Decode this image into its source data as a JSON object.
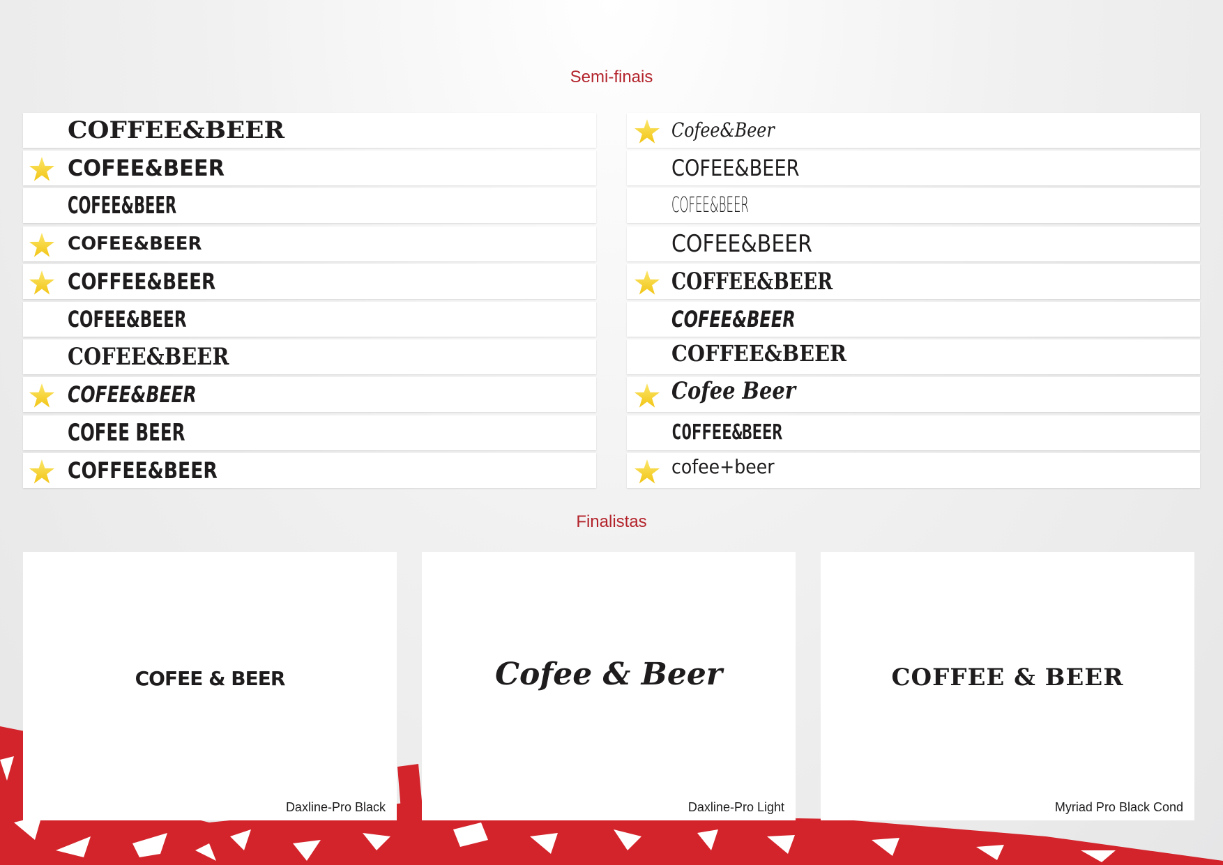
{
  "semifinals_title": "Semi-finais",
  "finalists_title": "Finalistas",
  "colors": {
    "accent": "#b3232b",
    "star": "#f5d21f",
    "decor_red": "#d3242b"
  },
  "semifinals": {
    "left": [
      {
        "text": "COFFEE&BEER",
        "starred": false
      },
      {
        "text": "COFEE&BEER",
        "starred": true
      },
      {
        "text": "COFEE&BEER",
        "starred": false
      },
      {
        "text": "COFEE&BEER",
        "starred": true
      },
      {
        "text": "COFFEE&BEER",
        "starred": true
      },
      {
        "text": "COFEE&BEER",
        "starred": false
      },
      {
        "text": "COFEE&BEER",
        "starred": false
      },
      {
        "text": "COFEE&BEER",
        "starred": true
      },
      {
        "text": "COFEE BEER",
        "starred": false
      },
      {
        "text": "COFFEE&BEER",
        "starred": true
      }
    ],
    "right": [
      {
        "text": "Cofee&Beer",
        "starred": true
      },
      {
        "text": "COFEE&BEER",
        "starred": false
      },
      {
        "text": "COFEE&BEER",
        "starred": false
      },
      {
        "text": "COFEE&BEER",
        "starred": false
      },
      {
        "text": "COFFEE&BEER",
        "starred": true
      },
      {
        "text": "COFEE&BEER",
        "starred": false
      },
      {
        "text": "COFFEE&BEER",
        "starred": false
      },
      {
        "text": "Cofee Beer",
        "starred": true
      },
      {
        "text": "COFFEE&BEER",
        "starred": false
      },
      {
        "text": "cofee+beer",
        "starred": true
      }
    ]
  },
  "finalists": [
    {
      "logo": "COFEE & BEER",
      "font_caption": "Daxline-Pro Black"
    },
    {
      "logo": "Cofee & Beer",
      "font_caption": "Daxline-Pro Light"
    },
    {
      "logo": "COFFEE & BEER",
      "font_caption": "Myriad Pro Black Cond"
    }
  ]
}
